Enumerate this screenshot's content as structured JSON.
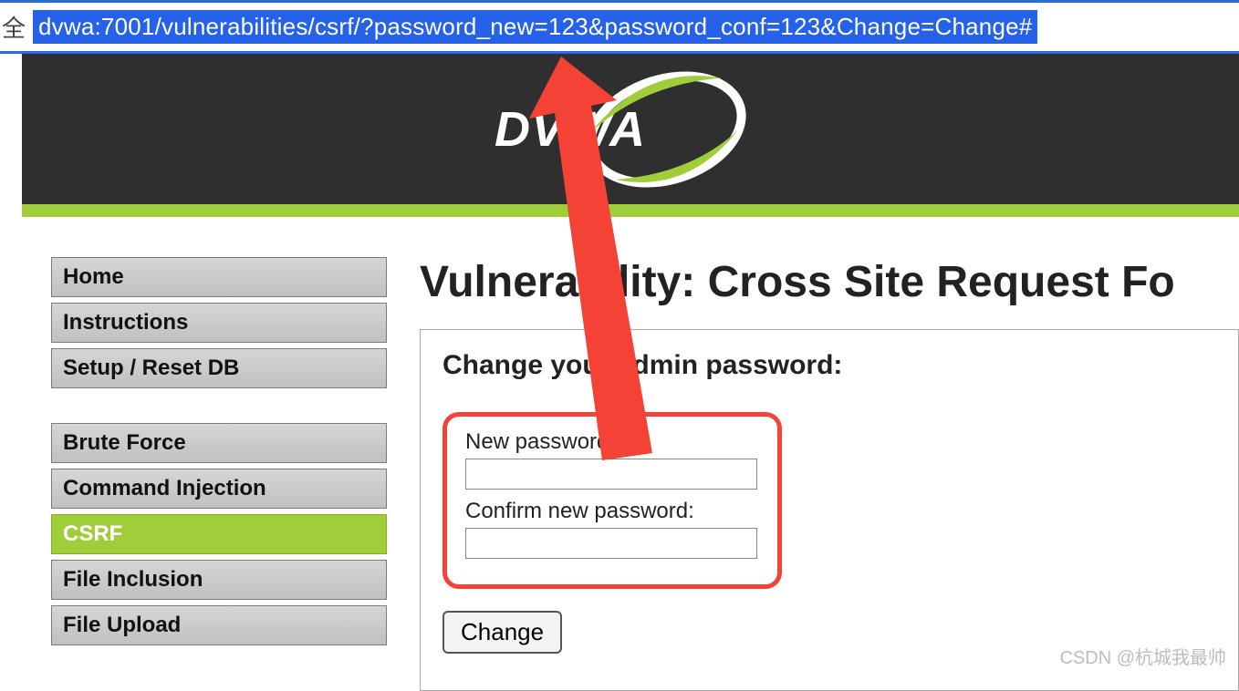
{
  "address_bar": {
    "left_fragment": "全",
    "url": "dvwa:7001/vulnerabilities/csrf/?password_new=123&password_conf=123&Change=Change#"
  },
  "header": {
    "logo_text": "DVWA"
  },
  "sidebar": {
    "group1": [
      {
        "label": "Home",
        "active": false
      },
      {
        "label": "Instructions",
        "active": false
      },
      {
        "label": "Setup / Reset DB",
        "active": false
      }
    ],
    "group2": [
      {
        "label": "Brute Force",
        "active": false
      },
      {
        "label": "Command Injection",
        "active": false
      },
      {
        "label": "CSRF",
        "active": true
      },
      {
        "label": "File Inclusion",
        "active": false
      },
      {
        "label": "File Upload",
        "active": false
      }
    ]
  },
  "main": {
    "title": "Vulnerability: Cross Site Request Fo",
    "form_heading": "Change your admin password:",
    "new_password_label": "New password:",
    "confirm_password_label": "Confirm new password:",
    "change_button": "Change"
  },
  "watermark": "CSDN @杭城我最帅",
  "colors": {
    "accent_green": "#a0ce3a",
    "arrow_red": "#f44336",
    "url_highlight": "#2661e9"
  }
}
